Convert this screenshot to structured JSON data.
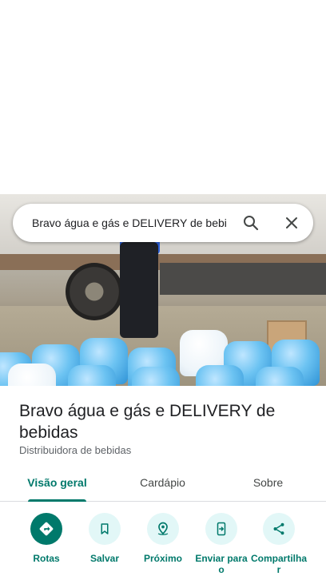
{
  "search": {
    "query": "Bravo água e gás e DELIVERY de bebi"
  },
  "place": {
    "title": "Bravo água e gás e DELIVERY de bebidas",
    "category": "Distribuidora de bebidas"
  },
  "tabs": [
    {
      "label": "Visão geral",
      "active": true
    },
    {
      "label": "Cardápio",
      "active": false
    },
    {
      "label": "Sobre",
      "active": false
    }
  ],
  "actions": [
    {
      "label": "Rotas",
      "icon": "directions-icon"
    },
    {
      "label": "Salvar",
      "icon": "bookmark-icon"
    },
    {
      "label": "Próximo",
      "icon": "nearby-icon"
    },
    {
      "label": "Enviar para\no\n.",
      "icon": "send-to-phone-icon"
    },
    {
      "label": "Compartilha\nr",
      "icon": "share-icon"
    }
  ],
  "colors": {
    "accent": "#00796b",
    "accent_light": "#e2f7f7",
    "text_primary": "#202124",
    "text_secondary": "#5f6368"
  }
}
